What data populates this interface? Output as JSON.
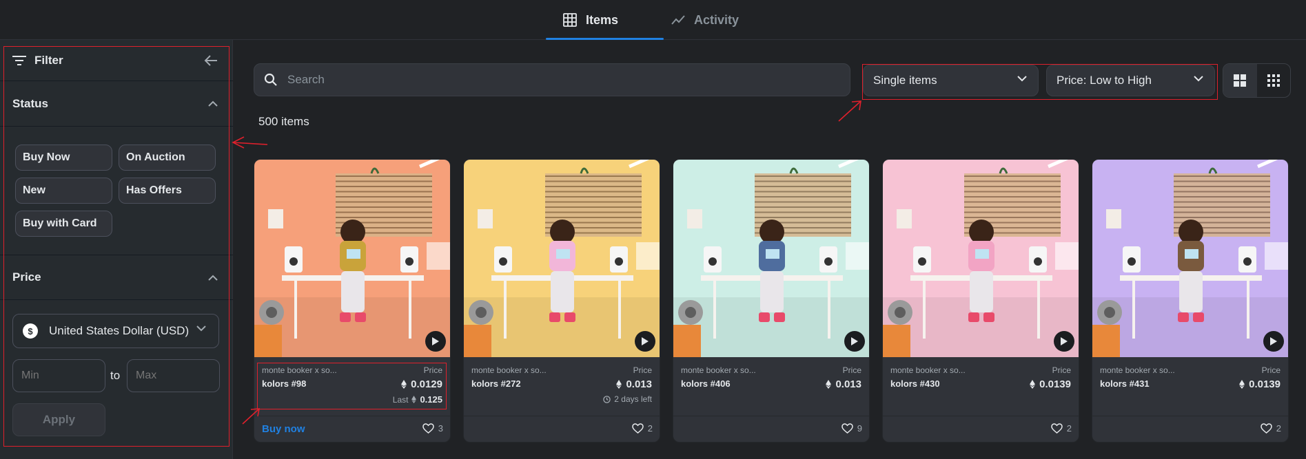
{
  "tabs": [
    {
      "label": "Items",
      "icon": "grid-icon",
      "active": true
    },
    {
      "label": "Activity",
      "icon": "activity-icon",
      "active": false
    }
  ],
  "filter": {
    "title": "Filter",
    "status": {
      "title": "Status",
      "options": [
        "Buy Now",
        "On Auction",
        "New",
        "Has Offers",
        "Buy with Card"
      ]
    },
    "price": {
      "title": "Price",
      "currency": "United States Dollar (USD)",
      "currency_symbol": "$",
      "min_placeholder": "Min",
      "to_label": "to",
      "max_placeholder": "Max",
      "apply_label": "Apply"
    }
  },
  "toolbar": {
    "search_placeholder": "Search",
    "item_type": "Single items",
    "sort": "Price: Low to High"
  },
  "results": {
    "count_label": "500 items"
  },
  "cards": [
    {
      "collection": "monte booker x so...",
      "name": "kolors #98",
      "price_label": "Price",
      "price": "0.0129",
      "last_label": "Last",
      "last_price": "0.125",
      "time_left": "",
      "buy_label": "Buy now",
      "likes": "3",
      "bg": "#f6a07a",
      "accent": "#c9a33a"
    },
    {
      "collection": "monte booker x so...",
      "name": "kolors #272",
      "price_label": "Price",
      "price": "0.013",
      "last_label": "",
      "last_price": "",
      "time_left": "2 days left",
      "buy_label": "",
      "likes": "2",
      "bg": "#f7d27a",
      "accent": "#f2b6d9"
    },
    {
      "collection": "monte booker x so...",
      "name": "kolors #406",
      "price_label": "Price",
      "price": "0.013",
      "last_label": "",
      "last_price": "",
      "time_left": "",
      "buy_label": "",
      "likes": "9",
      "bg": "#cdeee6",
      "accent": "#4f6d9e"
    },
    {
      "collection": "monte booker x so...",
      "name": "kolors #430",
      "price_label": "Price",
      "price": "0.0139",
      "last_label": "",
      "last_price": "",
      "time_left": "",
      "buy_label": "",
      "likes": "2",
      "bg": "#f7c3d4",
      "accent": "#f2a4c4"
    },
    {
      "collection": "monte booker x so...",
      "name": "kolors #431",
      "price_label": "Price",
      "price": "0.0139",
      "last_label": "",
      "last_price": "",
      "time_left": "",
      "buy_label": "",
      "likes": "2",
      "bg": "#c8b2f2",
      "accent": "#7a5a3e"
    }
  ],
  "colors": {
    "accent_blue": "#2081e2",
    "annotation_red": "#e0202c"
  }
}
